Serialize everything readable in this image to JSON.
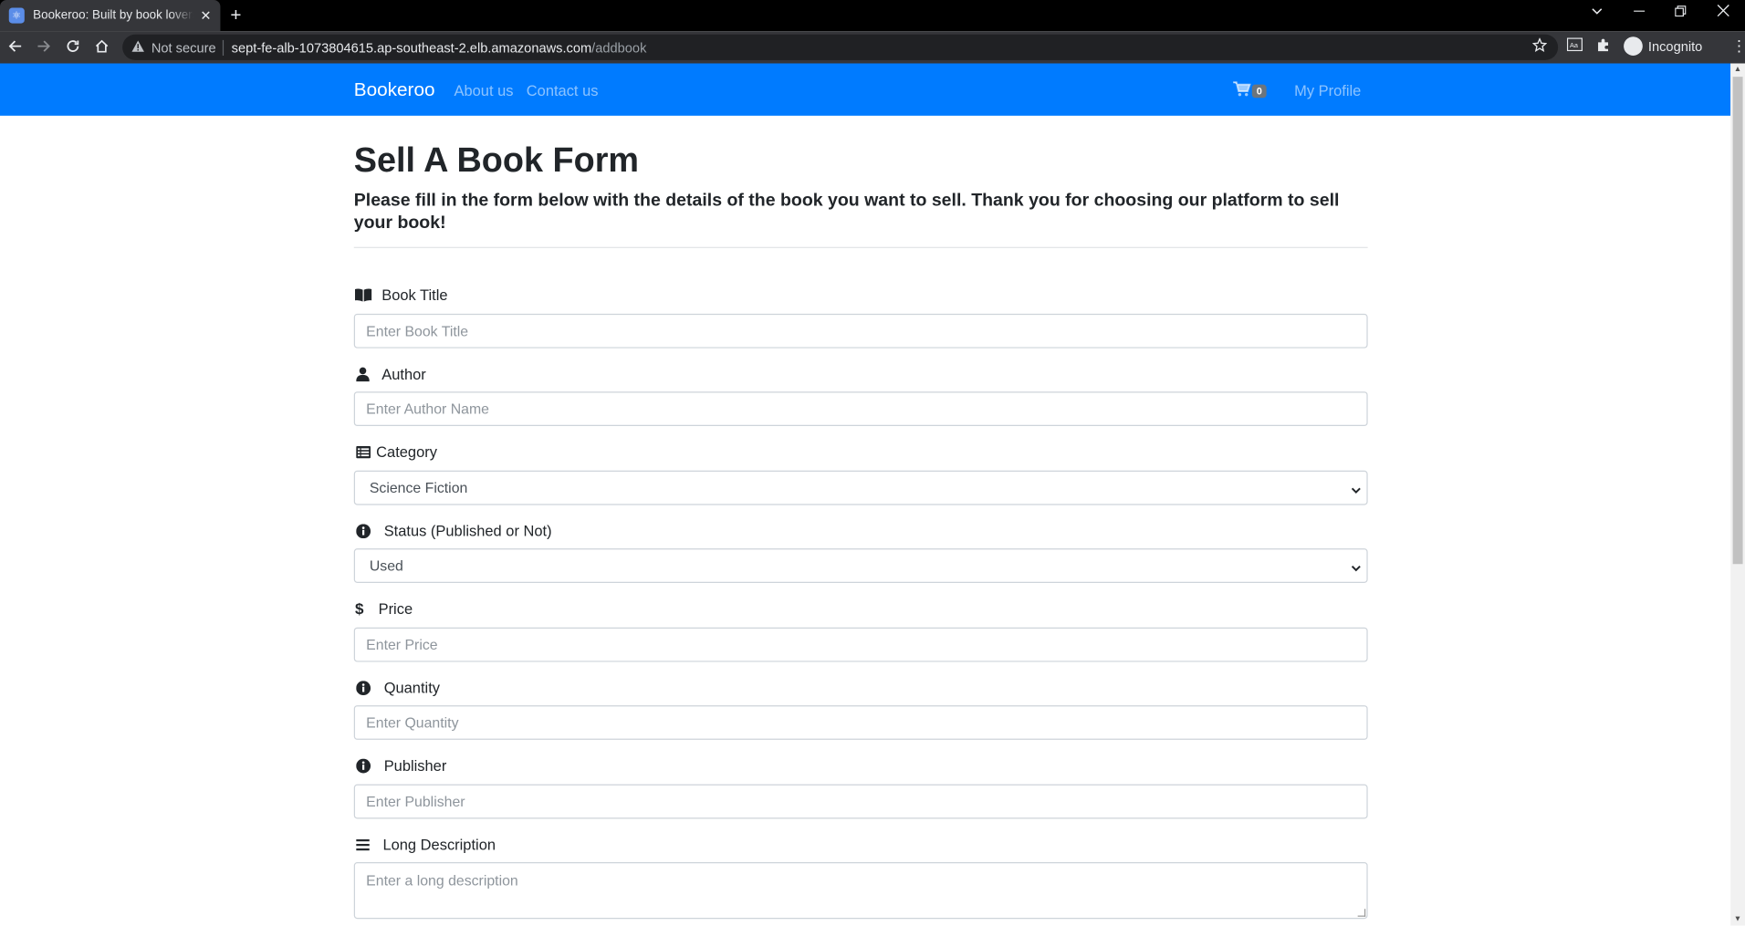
{
  "browser": {
    "tab_title": "Bookeroo: Built by book lovers, f",
    "new_tab_symbol": "+",
    "not_secure_label": "Not secure",
    "url_host": "sept-fe-alb-1073804615.ap-southeast-2.elb.amazonaws.com",
    "url_path": "/addbook",
    "profile_label": "Incognito"
  },
  "navbar": {
    "brand": "Bookeroo",
    "links": [
      "About us",
      "Contact us"
    ],
    "cart_count": "0",
    "profile_link": "My Profile",
    "accent_color": "#007bff"
  },
  "page": {
    "title": "Sell A Book Form",
    "subtitle": "Please fill in the form below with the details of the book you want to sell. Thank you for choosing our platform to sell your book!"
  },
  "form": {
    "book_title": {
      "label": "Book Title",
      "placeholder": "Enter Book Title",
      "icon": "book-open-icon"
    },
    "author": {
      "label": "Author",
      "placeholder": "Enter Author Name",
      "icon": "user-icon"
    },
    "category": {
      "label": "Category",
      "selected": "Science Fiction",
      "icon": "list-alt-icon"
    },
    "status": {
      "label": "Status (Published or Not)",
      "selected": "Used",
      "icon": "info-circle-icon"
    },
    "price": {
      "label": "Price",
      "placeholder": "Enter Price",
      "icon": "dollar-icon"
    },
    "quantity": {
      "label": "Quantity",
      "placeholder": "Enter Quantity",
      "icon": "info-circle-icon"
    },
    "publisher": {
      "label": "Publisher",
      "placeholder": "Enter Publisher",
      "icon": "info-circle-icon"
    },
    "long_description": {
      "label": "Long Description",
      "placeholder": "Enter a long description",
      "icon": "bars-icon"
    }
  }
}
